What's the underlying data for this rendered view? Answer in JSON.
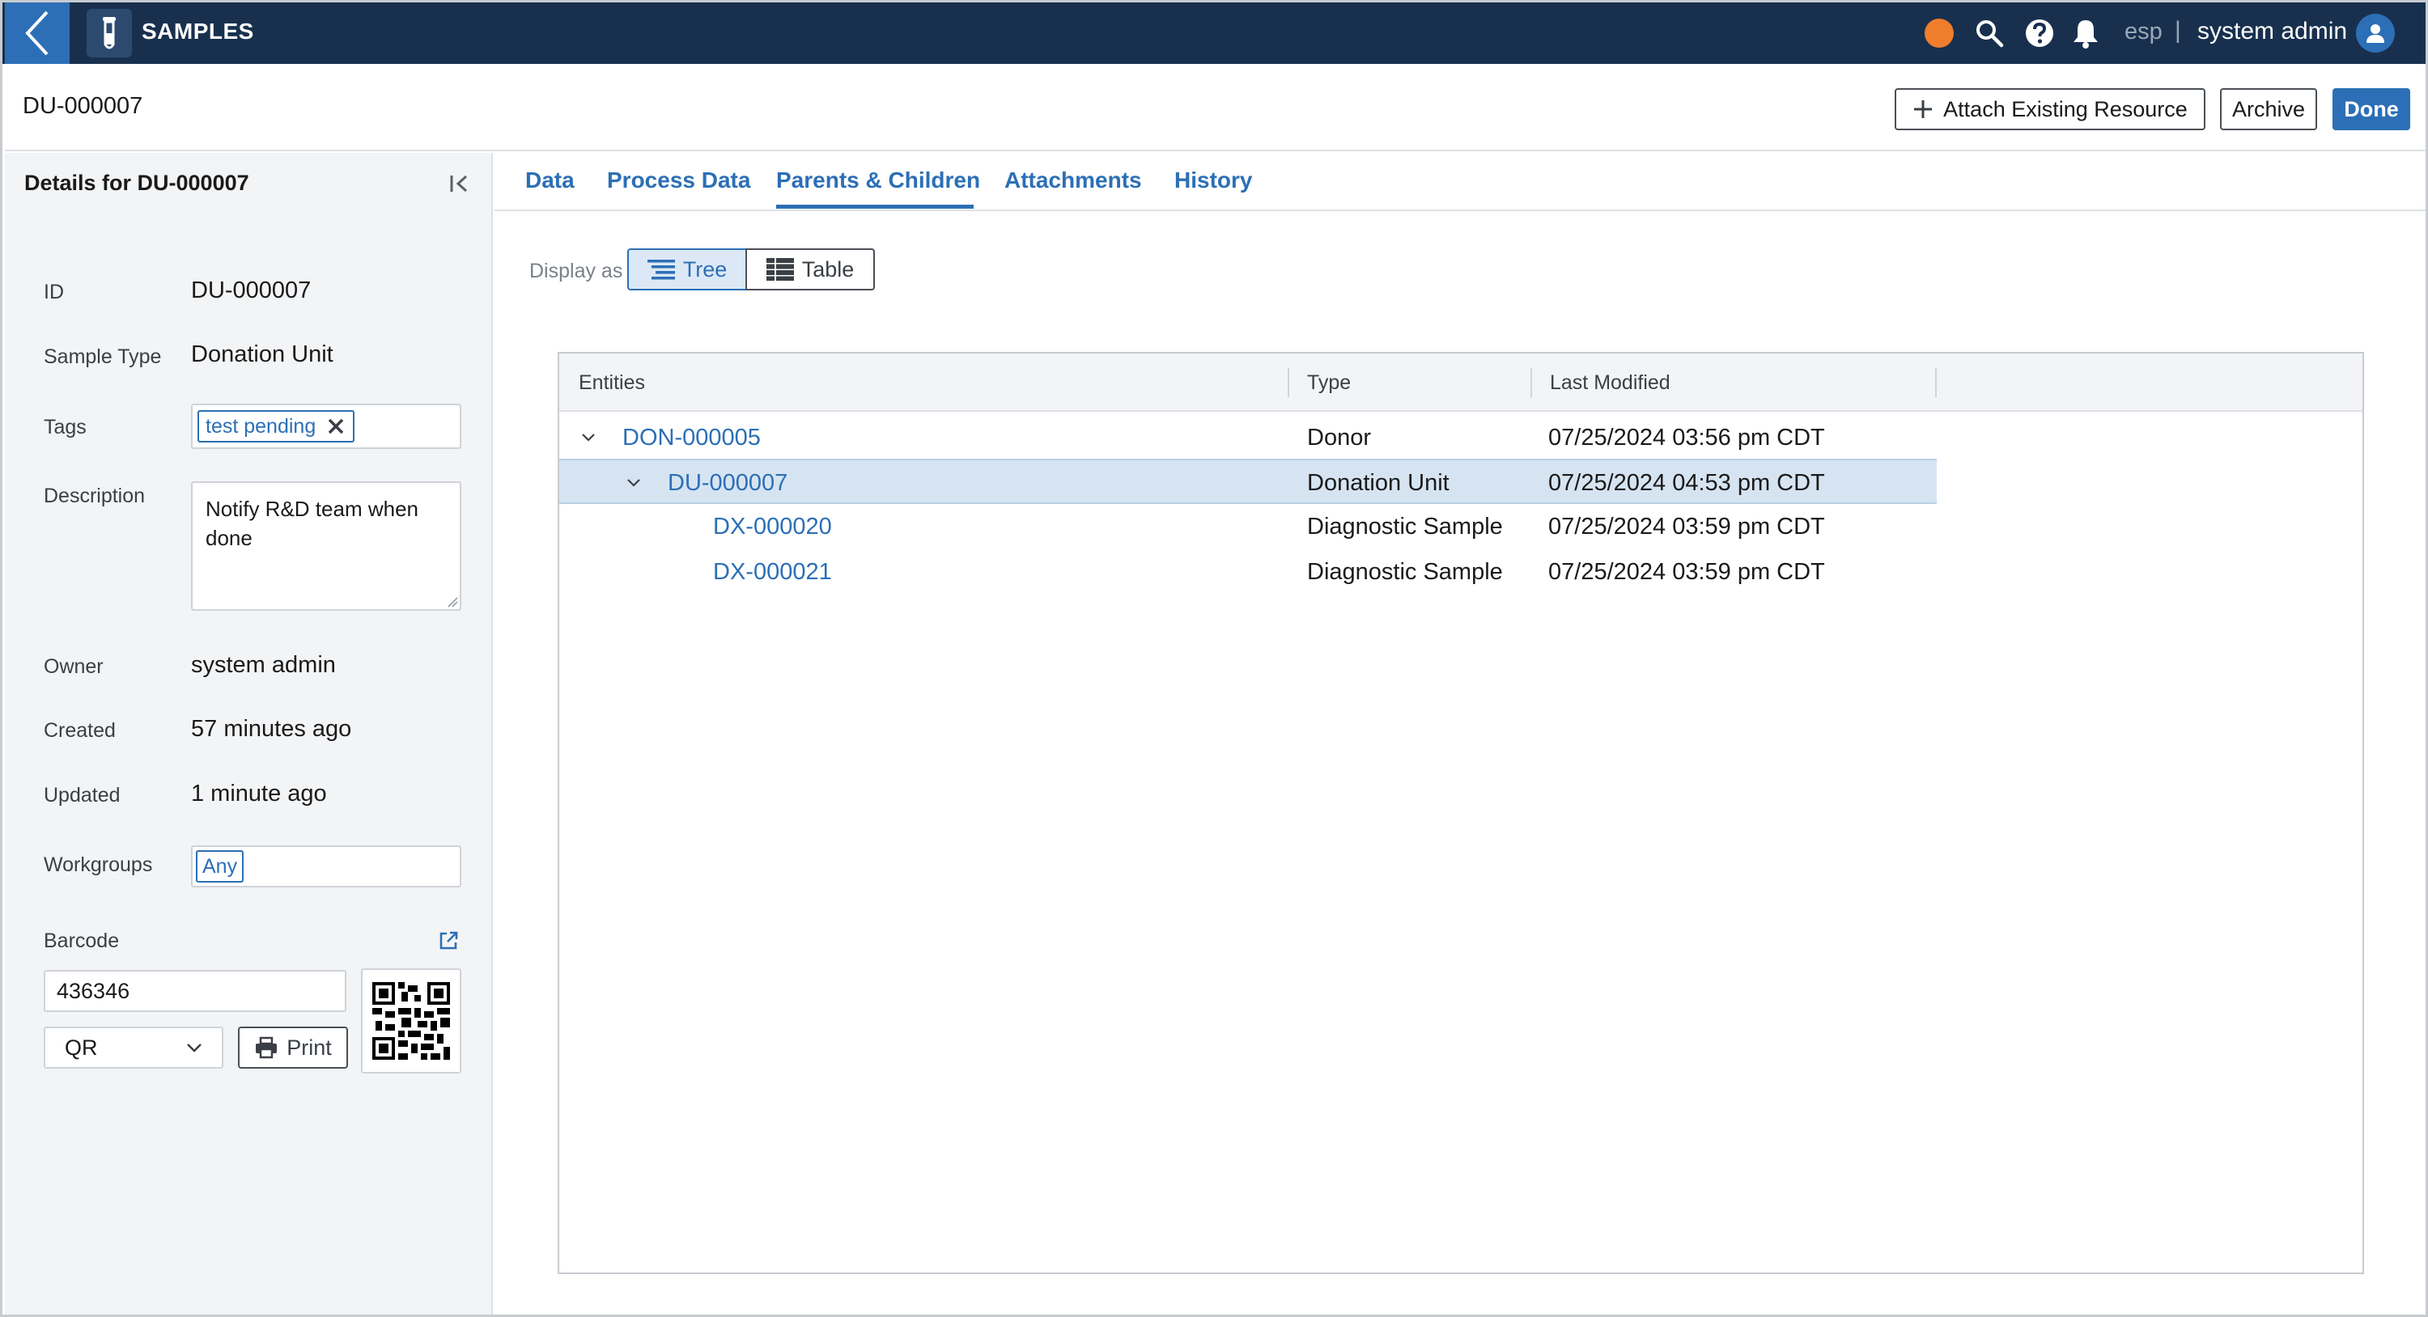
{
  "app": {
    "name": "SAMPLES",
    "tenant": "esp",
    "tenant_separator": "|",
    "user": "system admin",
    "status_color": "#ef7d2c",
    "accent": "#2c6fb6",
    "nav_bg": "#18304e"
  },
  "header": {
    "title": "DU-000007",
    "attach_label": "Attach Existing Resource",
    "archive_label": "Archive",
    "done_label": "Done"
  },
  "details": {
    "title": "Details for DU-000007",
    "id_label": "ID",
    "id_value": "DU-000007",
    "type_label": "Sample Type",
    "type_value": "Donation Unit",
    "tags_label": "Tags",
    "tags": [
      "test pending"
    ],
    "description_label": "Description",
    "description": "Notify R&D team when done",
    "owner_label": "Owner",
    "owner_value": "system admin",
    "created_label": "Created",
    "created_value": "57 minutes ago",
    "updated_label": "Updated",
    "updated_value": "1 minute ago",
    "workgroups_label": "Workgroups",
    "workgroups": [
      "Any"
    ],
    "barcode_label": "Barcode",
    "barcode_value": "436346",
    "barcode_type": "QR",
    "print_label": "Print"
  },
  "tabs": [
    {
      "label": "Data"
    },
    {
      "label": "Process Data"
    },
    {
      "label": "Parents & Children",
      "active": true
    },
    {
      "label": "Attachments"
    },
    {
      "label": "History"
    }
  ],
  "display_as": {
    "label": "Display as",
    "options": [
      "Tree",
      "Table"
    ],
    "selected": "Tree"
  },
  "grid": {
    "columns": [
      "Entities",
      "Type",
      "Last Modified"
    ],
    "rows": [
      {
        "entity": "DON-000005",
        "type": "Donor",
        "modified": "07/25/2024 03:56 pm CDT",
        "level": 0,
        "expanded": true
      },
      {
        "entity": "DU-000007",
        "type": "Donation Unit",
        "modified": "07/25/2024 04:53 pm CDT",
        "level": 1,
        "expanded": true,
        "selected": true
      },
      {
        "entity": "DX-000020",
        "type": "Diagnostic Sample",
        "modified": "07/25/2024 03:59 pm CDT",
        "level": 2
      },
      {
        "entity": "DX-000021",
        "type": "Diagnostic Sample",
        "modified": "07/25/2024 03:59 pm CDT",
        "level": 2
      }
    ]
  }
}
